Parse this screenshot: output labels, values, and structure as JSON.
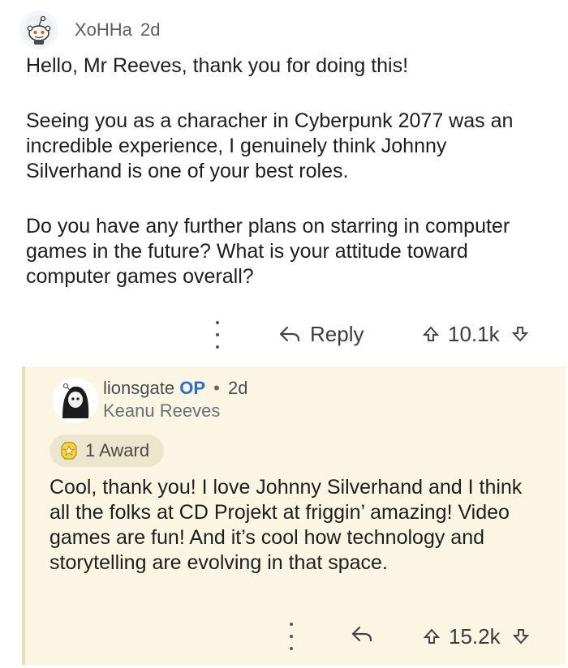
{
  "parent": {
    "username": "XoHHa",
    "age": "2d",
    "paragraphs": [
      "Hello, Mr Reeves, thank you for doing this!",
      "Seeing you as a characher in Cyberpunk 2077 was an incredible experience, I genuinely think Johnny Silverhand is one of your best roles.",
      "Do you have any further plans on starring in computer games in the future? What is your attitude toward computer games overall?"
    ],
    "reply_label": "Reply",
    "score": "10.1k"
  },
  "reply": {
    "username": "lionsgate",
    "op_tag": "OP",
    "separator": "•",
    "age": "2d",
    "flair": "Keanu Reeves",
    "award_label": "1 Award",
    "text": "Cool, thank you! I love Johnny Silverhand and I think all the folks at CD Projekt at friggin’ amazing! Video games are fun! And it’s cool how technology and storytelling are evolving in that space.",
    "score": "15.2k"
  },
  "colors": {
    "reply_background": "#faf6e3",
    "op_blue": "#2d6fc4",
    "thread_line": "#e6dfb6"
  }
}
